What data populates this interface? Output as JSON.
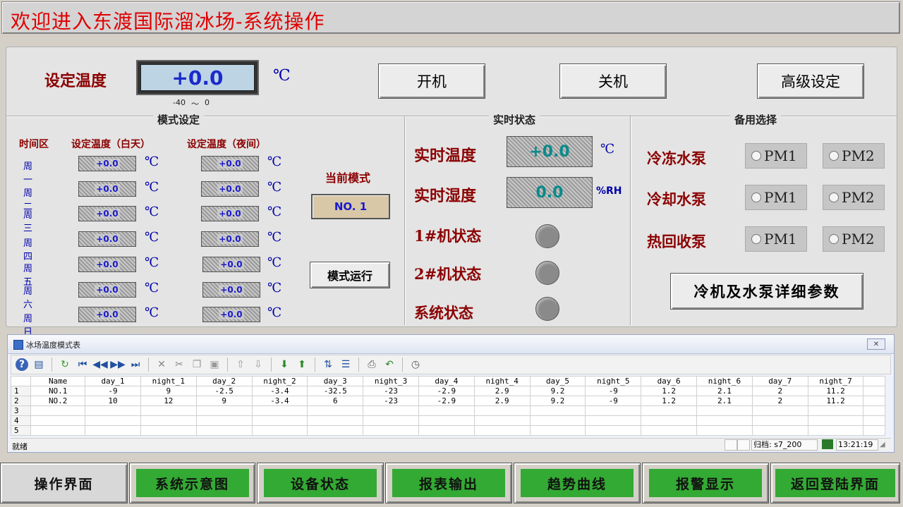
{
  "title": "欢迎进入东渡国际溜冰场-系统操作",
  "setpoint": {
    "label": "设定温度",
    "value": "+0.0",
    "unit": "℃",
    "range_min": "-40",
    "range_sep": "～",
    "range_max": "0"
  },
  "buttons": {
    "start": "开机",
    "stop": "关机",
    "advanced": "高级设定"
  },
  "mode": {
    "title": "模式设定",
    "col_zone": "时间区",
    "col_day": "设定温度（白天）",
    "col_night": "设定温度（夜间）",
    "unit": "℃",
    "rows": [
      {
        "day": "周一",
        "day_val": "+0.0",
        "night_val": "+0.0"
      },
      {
        "day": "周二",
        "day_val": "+0.0",
        "night_val": "+0.0"
      },
      {
        "day": "周三",
        "day_val": "+0.0",
        "night_val": "+0.0"
      },
      {
        "day": "周四",
        "day_val": "+0.0",
        "night_val": "+0.0"
      },
      {
        "day": "周五",
        "day_val": "+0.0",
        "night_val": "+0.0"
      },
      {
        "day": "周六",
        "day_val": "+0.0",
        "night_val": "+0.0"
      },
      {
        "day": "周日",
        "day_val": "+0.0",
        "night_val": "+0.0"
      }
    ],
    "current_label": "当前模式",
    "current_value": "NO. 1",
    "run_button": "模式运行"
  },
  "realtime": {
    "title": "实时状态",
    "temp_label": "实时温度",
    "temp_value": "+0.0",
    "temp_unit": "℃",
    "hum_label": "实时湿度",
    "hum_value": "0.0",
    "hum_unit": "%RH",
    "m1_label": "1#机状态",
    "m2_label": "2#机状态",
    "sys_label": "系统状态"
  },
  "backup": {
    "title": "备用选择",
    "pumps": [
      {
        "label": "冷冻水泵",
        "opt1": "PM1",
        "opt2": "PM2"
      },
      {
        "label": "冷却水泵",
        "opt1": "PM1",
        "opt2": "PM2"
      },
      {
        "label": "热回收泵",
        "opt1": "PM1",
        "opt2": "PM2"
      }
    ],
    "detail_button": "冷机及水泵详细参数"
  },
  "table": {
    "window_title": "冰场温度模式表",
    "columns": [
      "Name",
      "day_1",
      "night_1",
      "day_2",
      "night_2",
      "day_3",
      "night_3",
      "day_4",
      "night_4",
      "day_5",
      "night_5",
      "day_6",
      "night_6",
      "day_7",
      "night_7"
    ],
    "rows": [
      {
        "n": "1",
        "cells": [
          "NO.1",
          "-9",
          "9",
          "-2.5",
          "-3.4",
          "-32.5",
          "-23",
          "-2.9",
          "2.9",
          "9.2",
          "-9",
          "1.2",
          "2.1",
          "2",
          "11.2"
        ]
      },
      {
        "n": "2",
        "cells": [
          "NO.2",
          "10",
          "12",
          "9",
          "-3.4",
          "6",
          "-23",
          "-2.9",
          "2.9",
          "9.2",
          "-9",
          "1.2",
          "2.1",
          "2",
          "11.2"
        ]
      },
      {
        "n": "3",
        "cells": [
          "",
          "",
          "",
          "",
          "",
          "",
          "",
          "",
          "",
          "",
          "",
          "",
          "",
          "",
          ""
        ]
      },
      {
        "n": "4",
        "cells": [
          "",
          "",
          "",
          "",
          "",
          "",
          "",
          "",
          "",
          "",
          "",
          "",
          "",
          "",
          ""
        ]
      },
      {
        "n": "5",
        "cells": [
          "",
          "",
          "",
          "",
          "",
          "",
          "",
          "",
          "",
          "",
          "",
          "",
          "",
          "",
          ""
        ]
      }
    ],
    "status_left": "就绪",
    "archive": "归档: s7_200",
    "time": "13:21:19"
  },
  "nav": [
    "操作界面",
    "系统示意图",
    "设备状态",
    "报表输出",
    "趋势曲线",
    "报警显示",
    "返回登陆界面"
  ],
  "colors": {
    "title_red": "#e00000",
    "label_red": "#8b0000",
    "nav_green": "#33aa33",
    "unit_blue": "#0000aa"
  }
}
